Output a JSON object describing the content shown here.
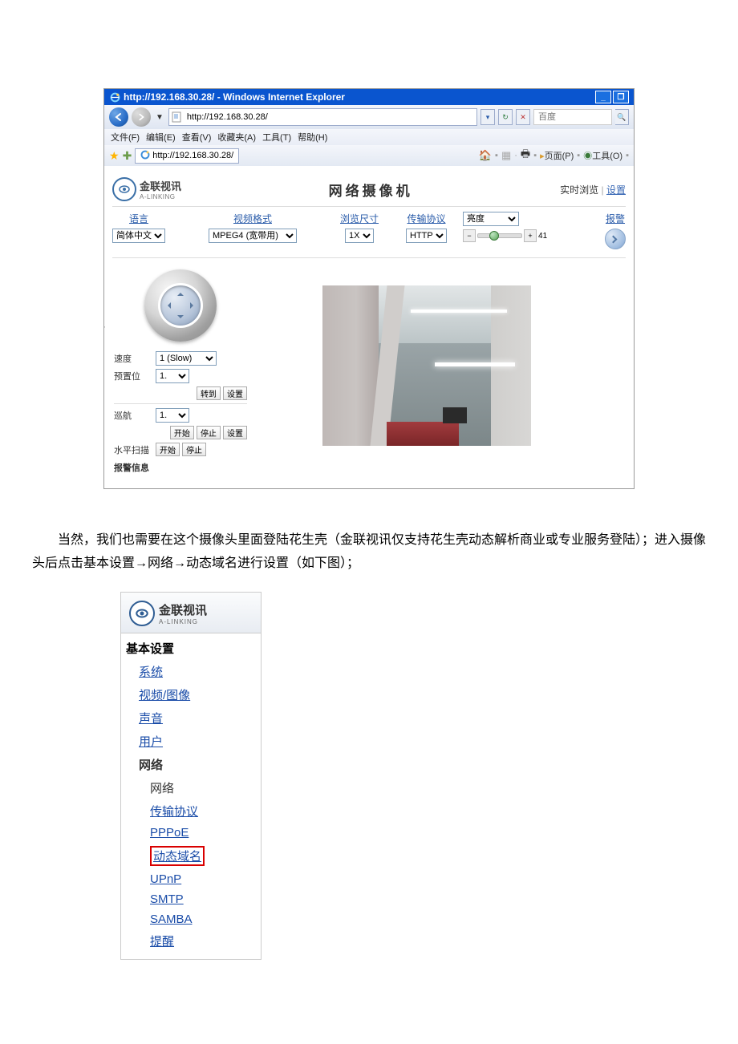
{
  "ie": {
    "titlebar": "http://192.168.30.28/ - Windows Internet Explorer",
    "url": "http://192.168.30.28/",
    "search_placeholder": "百度",
    "menu": {
      "file": "文件(F)",
      "edit": "编辑(E)",
      "view": "查看(V)",
      "fav": "收藏夹(A)",
      "tools": "工具(T)",
      "help": "帮助(H)"
    },
    "tab_text": "http://192.168.30.28/",
    "rightbar": {
      "page": "页面(P)",
      "tools": "工具(O)"
    }
  },
  "cam": {
    "logo_main": "金联视讯",
    "logo_sub": "A-LINKING",
    "title": "网络摄像机",
    "realtime": "实时浏览",
    "settings": "设置",
    "ctrl": {
      "lang_label": "语言",
      "lang_value": "简体中文",
      "fmt_label": "视频格式",
      "fmt_value": "MPEG4 (宽带用)",
      "size_label": "浏览尺寸",
      "size_value": "1X",
      "proto_label": "传输协议",
      "proto_value": "HTTP",
      "bright_label": "亮度",
      "bright_value": "41",
      "alarm_label": "报警"
    },
    "ptz": {
      "speed_label": "速度",
      "speed_value": "1 (Slow)",
      "preset_label": "预置位",
      "preset_value": "1.",
      "goto": "转到",
      "set": "设置",
      "cruise_label": "巡航",
      "cruise_value": "1.",
      "start": "开始",
      "stop": "停止",
      "hscan_label": "水平扫描",
      "alarm_info": "报警信息"
    }
  },
  "paragraph": "当然，我们也需要在这个摄像头里面登陆花生壳（金联视讯仅支持花生壳动态解析商业或专业服务登陆）；进入摄像头后点击基本设置→网络→动态域名进行设置（如下图）；",
  "menu2": {
    "logo_main": "金联视讯",
    "logo_sub": "A-LINKING",
    "section": "基本设置",
    "system": "系统",
    "video": "视频/图像",
    "audio": "声音",
    "user": "用户",
    "network": "网络",
    "net_sub": "网络",
    "proto": "传输协议",
    "pppoe": "PPPoE",
    "ddns": "动态域名",
    "upnp": "UPnP",
    "smtp": "SMTP",
    "samba": "SAMBA",
    "alert": "提醒"
  }
}
